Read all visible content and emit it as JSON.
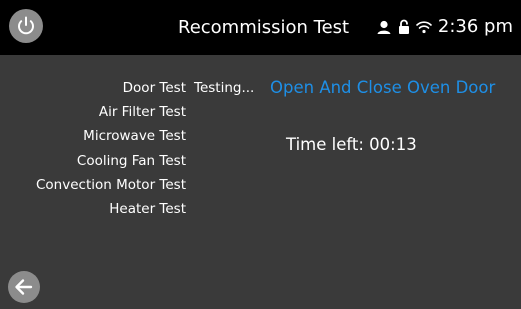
{
  "header": {
    "title": "Recommission Test",
    "time": "2:36 pm",
    "icons": [
      "power-icon",
      "user-icon",
      "lock-icon",
      "wifi-icon"
    ]
  },
  "tests": [
    "Door Test",
    "Air Filter Test",
    "Microwave Test",
    "Cooling Fan Test",
    "Convection Motor Test",
    "Heater Test"
  ],
  "status": {
    "testing_label": "Testing...",
    "instruction": "Open And Close Oven Door",
    "time_left": "Time left: 00:13"
  },
  "footer": {
    "icons": [
      "back-arrow-icon"
    ]
  },
  "colors": {
    "accent": "#1e8fe6",
    "header_bg": "#000000",
    "body_bg": "#3a3a3a",
    "button_bg": "#8c8c8c"
  }
}
